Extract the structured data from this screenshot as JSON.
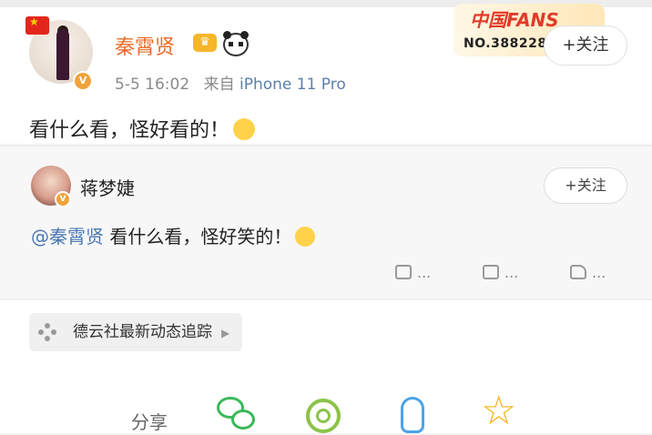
{
  "post": {
    "author": "秦霄贤",
    "time": "5-5 16:02",
    "source_prefix": "来自",
    "source": "iPhone 11 Pro",
    "text": "看什么看，怪好看的！",
    "follow_label": "+关注",
    "fans_badge": {
      "title": "中国FANS",
      "number": "NO.388228"
    }
  },
  "repost": {
    "author": "蒋梦婕",
    "follow_label": "+关注",
    "mention": "@秦霄贤",
    "text": " 看什么看，怪好笑的！",
    "actions": [
      {
        "icon": "share-icon",
        "label": "..."
      },
      {
        "icon": "comment-icon",
        "label": "..."
      },
      {
        "icon": "like-icon",
        "label": "..."
      }
    ]
  },
  "topic": {
    "label": "德云社最新动态追踪",
    "icon": "topic-icon"
  },
  "share": {
    "label": "分享",
    "targets": [
      "wechat-icon",
      "moments-icon",
      "qq-icon",
      "qzone-icon"
    ]
  },
  "colors": {
    "author": "#e86b2a",
    "link": "#4a77b3",
    "meta": "#8a8a8a"
  }
}
